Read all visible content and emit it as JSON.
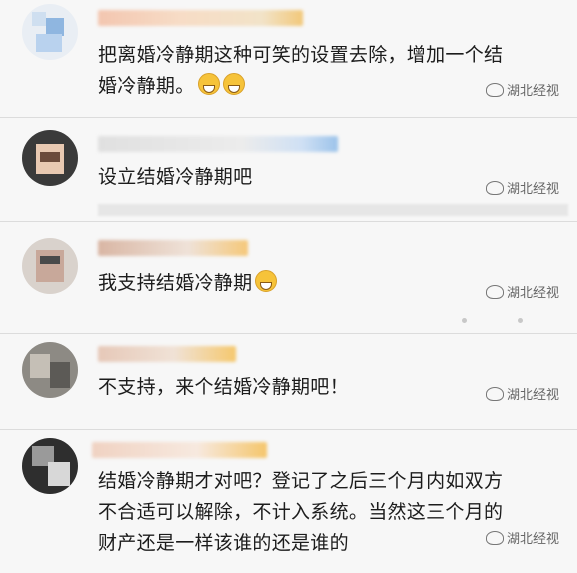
{
  "comments": [
    {
      "text_lines": [
        "把离婚冷静期这种可笑的设置去除，增加一个结",
        "婚冷静期。"
      ],
      "emoji_count": 2,
      "emoji_name": "grin-emoji"
    },
    {
      "text_lines": [
        "设立结婚冷静期吧"
      ],
      "emoji_count": 0
    },
    {
      "text_lines": [
        "我支持结婚冷静期"
      ],
      "emoji_count": 1,
      "emoji_name": "laugh-cry-emoji"
    },
    {
      "text_lines": [
        "不支持，来个结婚冷静期吧！"
      ],
      "emoji_count": 0
    },
    {
      "text_lines": [
        "结婚冷静期才对吧？登记了之后三个月内如双方",
        "不合适可以解除，不计入系统。当然这三个月的",
        "财产还是一样该谁的还是谁的"
      ],
      "emoji_count": 0
    }
  ],
  "watermark": {
    "label": "湖北经视",
    "icon": "broadcast-logo-icon"
  },
  "colors": {
    "background": "#f7f7f7",
    "divider": "#dcdcdc",
    "text": "#1c1c1c",
    "watermark": "#666666"
  }
}
